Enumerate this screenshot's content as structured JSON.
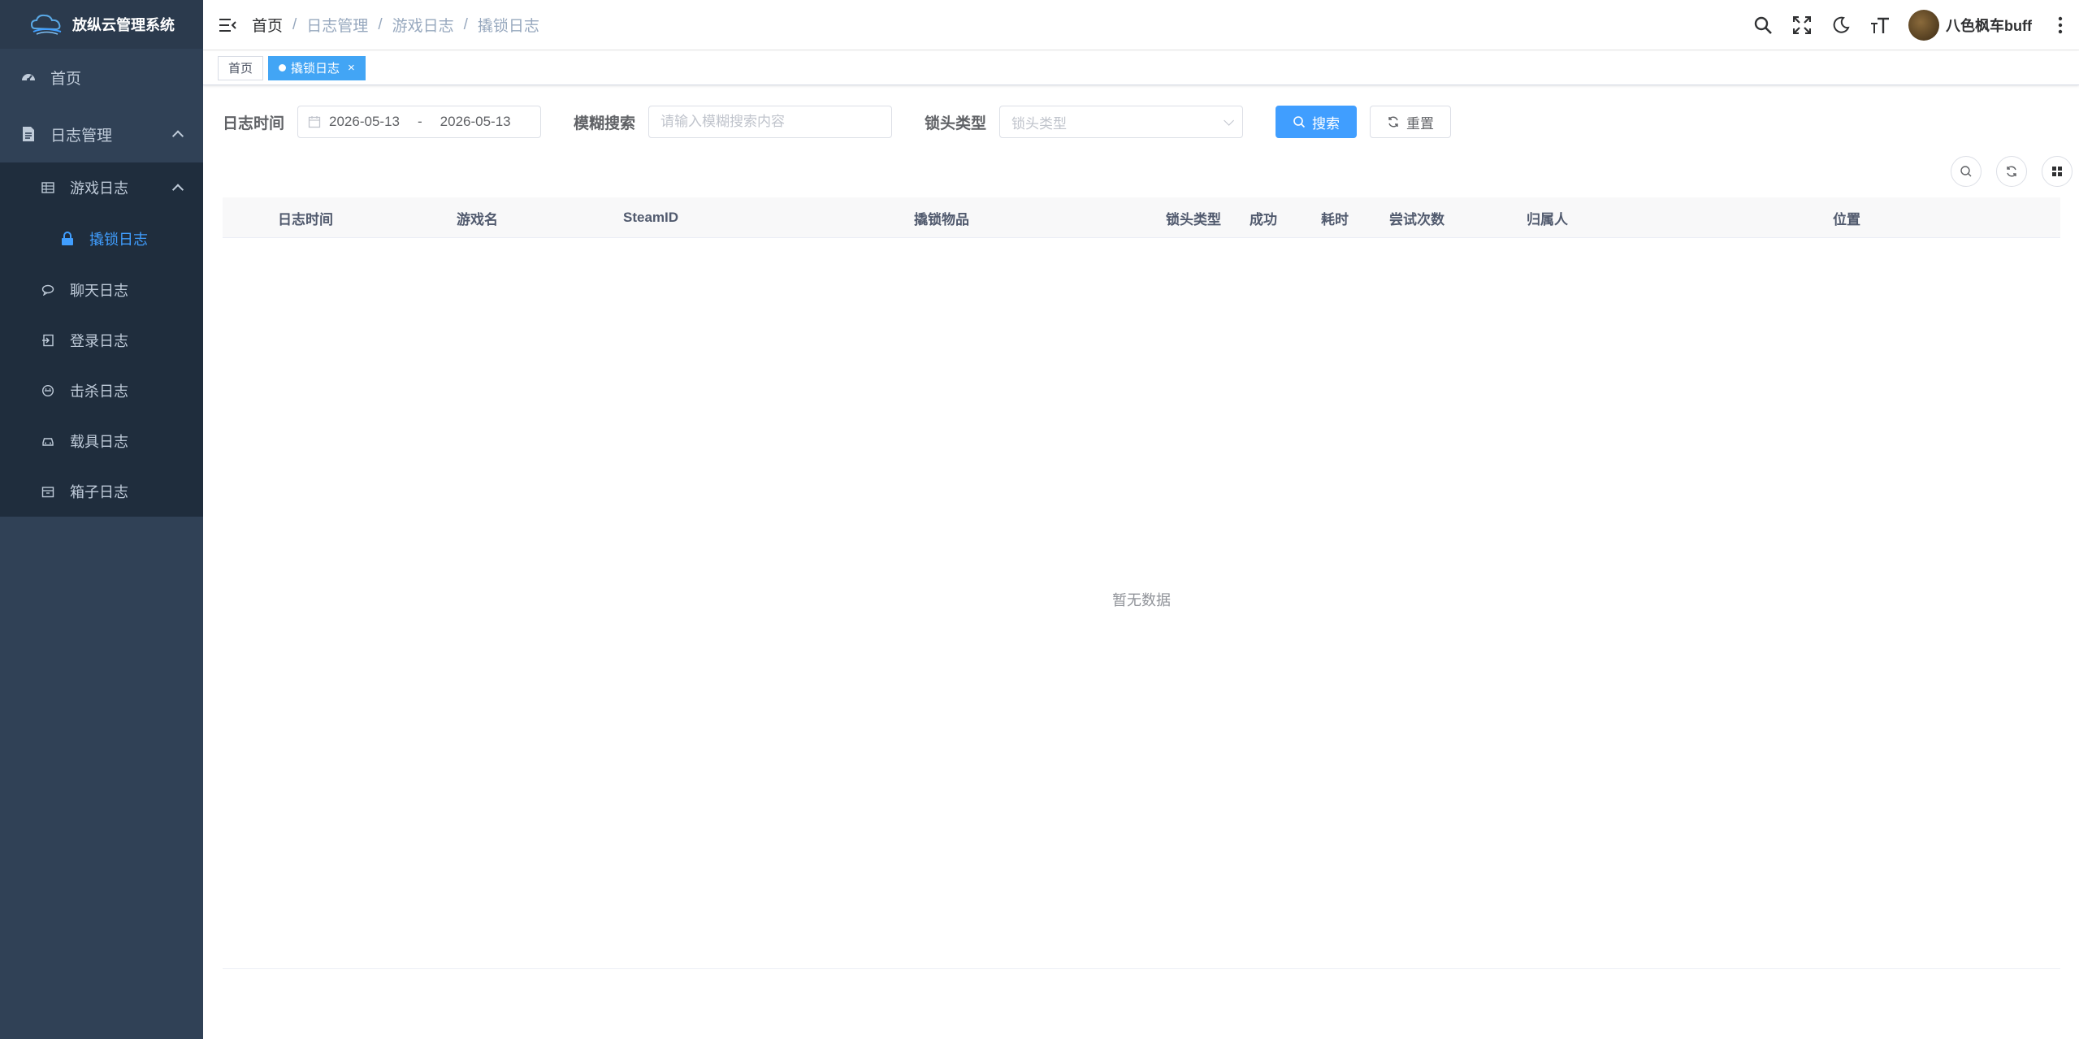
{
  "app": {
    "title": "放纵云管理系统"
  },
  "sidebar": {
    "home": "首页",
    "log_mgmt": "日志管理",
    "game_log": "游戏日志",
    "lockpick_log": "撬锁日志",
    "items": [
      "聊天日志",
      "登录日志",
      "击杀日志",
      "载具日志",
      "箱子日志"
    ]
  },
  "breadcrumb": [
    "首页",
    "日志管理",
    "游戏日志",
    "撬锁日志"
  ],
  "header": {
    "user_name": "八色枫车buff"
  },
  "tags": {
    "home": "首页",
    "active": "撬锁日志"
  },
  "search": {
    "date_label": "日志时间",
    "date_start": "2026-05-13",
    "date_sep": "-",
    "date_end": "2026-05-13",
    "fuzzy_label": "模糊搜索",
    "fuzzy_placeholder": "请输入模糊搜索内容",
    "lock_label": "锁头类型",
    "lock_placeholder": "锁头类型",
    "search_btn": "搜索",
    "reset_btn": "重置"
  },
  "table": {
    "columns": [
      "日志时间",
      "游戏名",
      "SteamID",
      "撬锁物品",
      "锁头类型",
      "成功",
      "耗时",
      "尝试次数",
      "归属人",
      "位置"
    ],
    "empty_text": "暂无数据"
  }
}
